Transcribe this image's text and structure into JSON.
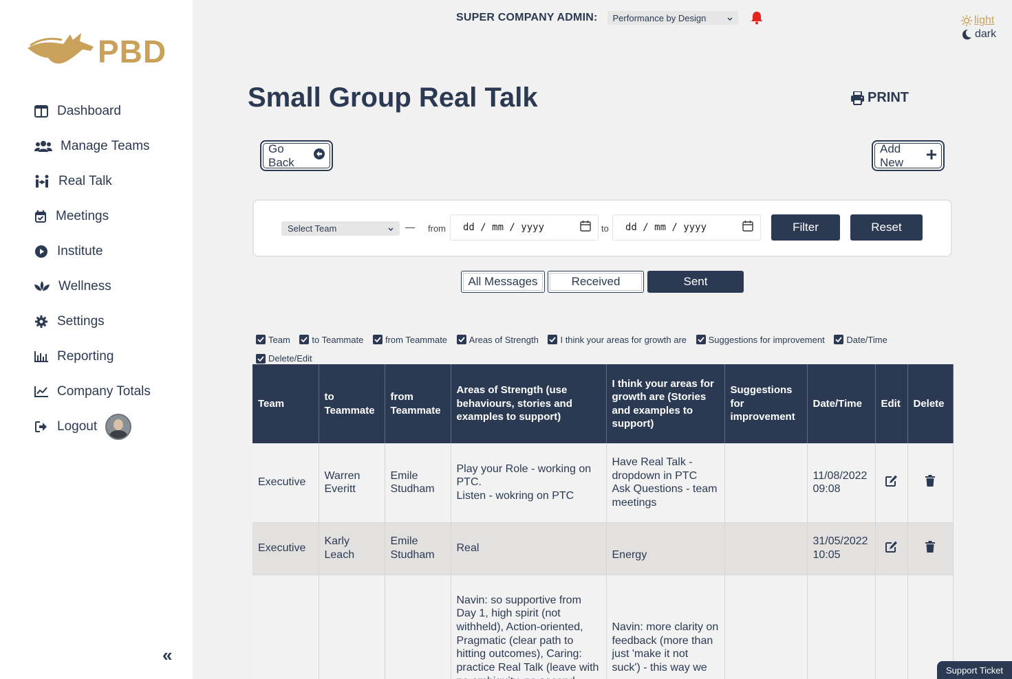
{
  "brand": {
    "logo_text": "PBD",
    "accent": "#c9a15a",
    "primary": "#2b3a52"
  },
  "sidebar": {
    "items": [
      {
        "label": "Dashboard",
        "icon": "columns-icon"
      },
      {
        "label": "Manage Teams",
        "icon": "users-icon"
      },
      {
        "label": "Real Talk",
        "icon": "people-arrows-icon"
      },
      {
        "label": "Meetings",
        "icon": "calendar-check-icon"
      },
      {
        "label": "Institute",
        "icon": "play-circle-icon"
      },
      {
        "label": "Wellness",
        "icon": "lotus-icon"
      },
      {
        "label": "Settings",
        "icon": "gear-icon"
      },
      {
        "label": "Reporting",
        "icon": "bar-chart-icon"
      },
      {
        "label": "Company Totals",
        "icon": "line-chart-icon"
      },
      {
        "label": "Logout",
        "icon": "sign-out-icon"
      }
    ],
    "collapse_glyph": "«"
  },
  "topbar": {
    "admin_label": "SUPER COMPANY ADMIN:",
    "company": "Performance by Design",
    "theme_light": "light",
    "theme_dark": "dark"
  },
  "page": {
    "title": "Small Group Real Talk",
    "print_label": "PRINT",
    "go_back_label": "Go Back",
    "add_new_label": "Add New"
  },
  "filter": {
    "team_placeholder": "Select Team",
    "dash": "—",
    "from_label": "from",
    "to_label": "to",
    "date_placeholder": "dd / mm / yyyy",
    "filter_label": "Filter",
    "reset_label": "Reset"
  },
  "segments": [
    {
      "label": "All Messages",
      "active": false
    },
    {
      "label": "Received",
      "active": false
    },
    {
      "label": "Sent",
      "active": true
    }
  ],
  "column_toggles": [
    "Team",
    "to Teammate",
    "from Teammate",
    "Areas of Strength",
    "I think your areas for growth are",
    "Suggestions for improvement",
    "Date/Time",
    "Delete/Edit"
  ],
  "table": {
    "headers": [
      "Team",
      "to Teammate",
      "from Teammate",
      "Areas of Strength (use behaviours, stories and examples to support)",
      "I think your areas for growth are (Stories and examples to support)",
      "Suggestions for improvement",
      "Date/Time",
      "Edit",
      "Delete"
    ],
    "rows": [
      {
        "team": "Executive",
        "to": "Warren\nEveritt",
        "from": "Emile\nStudham",
        "strength": "Play your Role - working on PTC.\nListen - wokring on PTC",
        "growth": "Have Real Talk - dropdown in PTC\nAsk Questions - team meetings",
        "suggestions": "",
        "datetime": "11/08/2022\n09:08"
      },
      {
        "team": "Executive",
        "to": "Karly\nLeach",
        "from": "Emile\nStudham",
        "strength": "Real",
        "growth": "\nEnergy",
        "suggestions": "",
        "datetime": "31/05/2022\n10:05"
      },
      {
        "team": "",
        "to": "",
        "from": "",
        "strength": "Navin: so supportive from Day 1, high spirit (not withheld), Action-oriented, Pragmatic (clear path to hitting outcomes), Caring: practice Real Talk (leave with no ambiguity, no second",
        "growth": "\n\nNavin: more clarity on feedback (more than just 'make it not suck') - this way we",
        "suggestions": "",
        "datetime": ""
      }
    ]
  },
  "support_label": "Support Ticket"
}
